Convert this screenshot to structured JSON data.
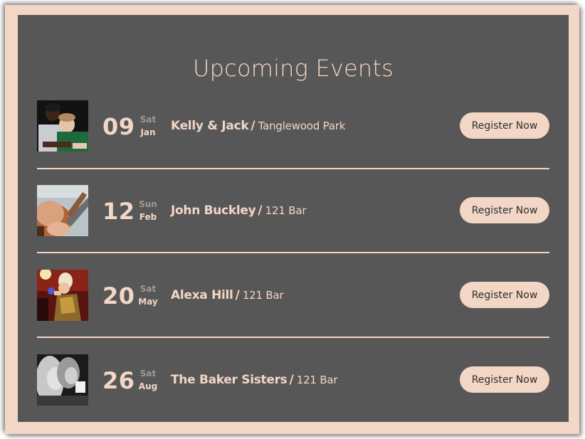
{
  "header": {
    "title": "Upcoming Events"
  },
  "colors": {
    "frame": "#f2d6c6",
    "panel": "#575757",
    "accent": "#f2d6c6",
    "button_text": "#2e2e2e"
  },
  "events": [
    {
      "day": "09",
      "weekday": "Sat",
      "month": "Jan",
      "name": "Kelly & Jack",
      "separator": "/",
      "venue": "Tanglewood Park",
      "button_label": "Register Now",
      "image": "couple-photo"
    },
    {
      "day": "12",
      "weekday": "Sun",
      "month": "Feb",
      "name": "John Buckley",
      "separator": "/",
      "venue": "121 Bar",
      "button_label": "Register Now",
      "image": "guitar-photo"
    },
    {
      "day": "20",
      "weekday": "Sat",
      "month": "May",
      "name": "Alexa Hill",
      "separator": "/",
      "venue": "121 Bar",
      "button_label": "Register Now",
      "image": "singer-photo"
    },
    {
      "day": "26",
      "weekday": "Sat",
      "month": "Aug",
      "name": "The Baker Sisters",
      "separator": "/",
      "venue": "121 Bar",
      "button_label": "Register Now",
      "image": "sisters-photo"
    }
  ]
}
